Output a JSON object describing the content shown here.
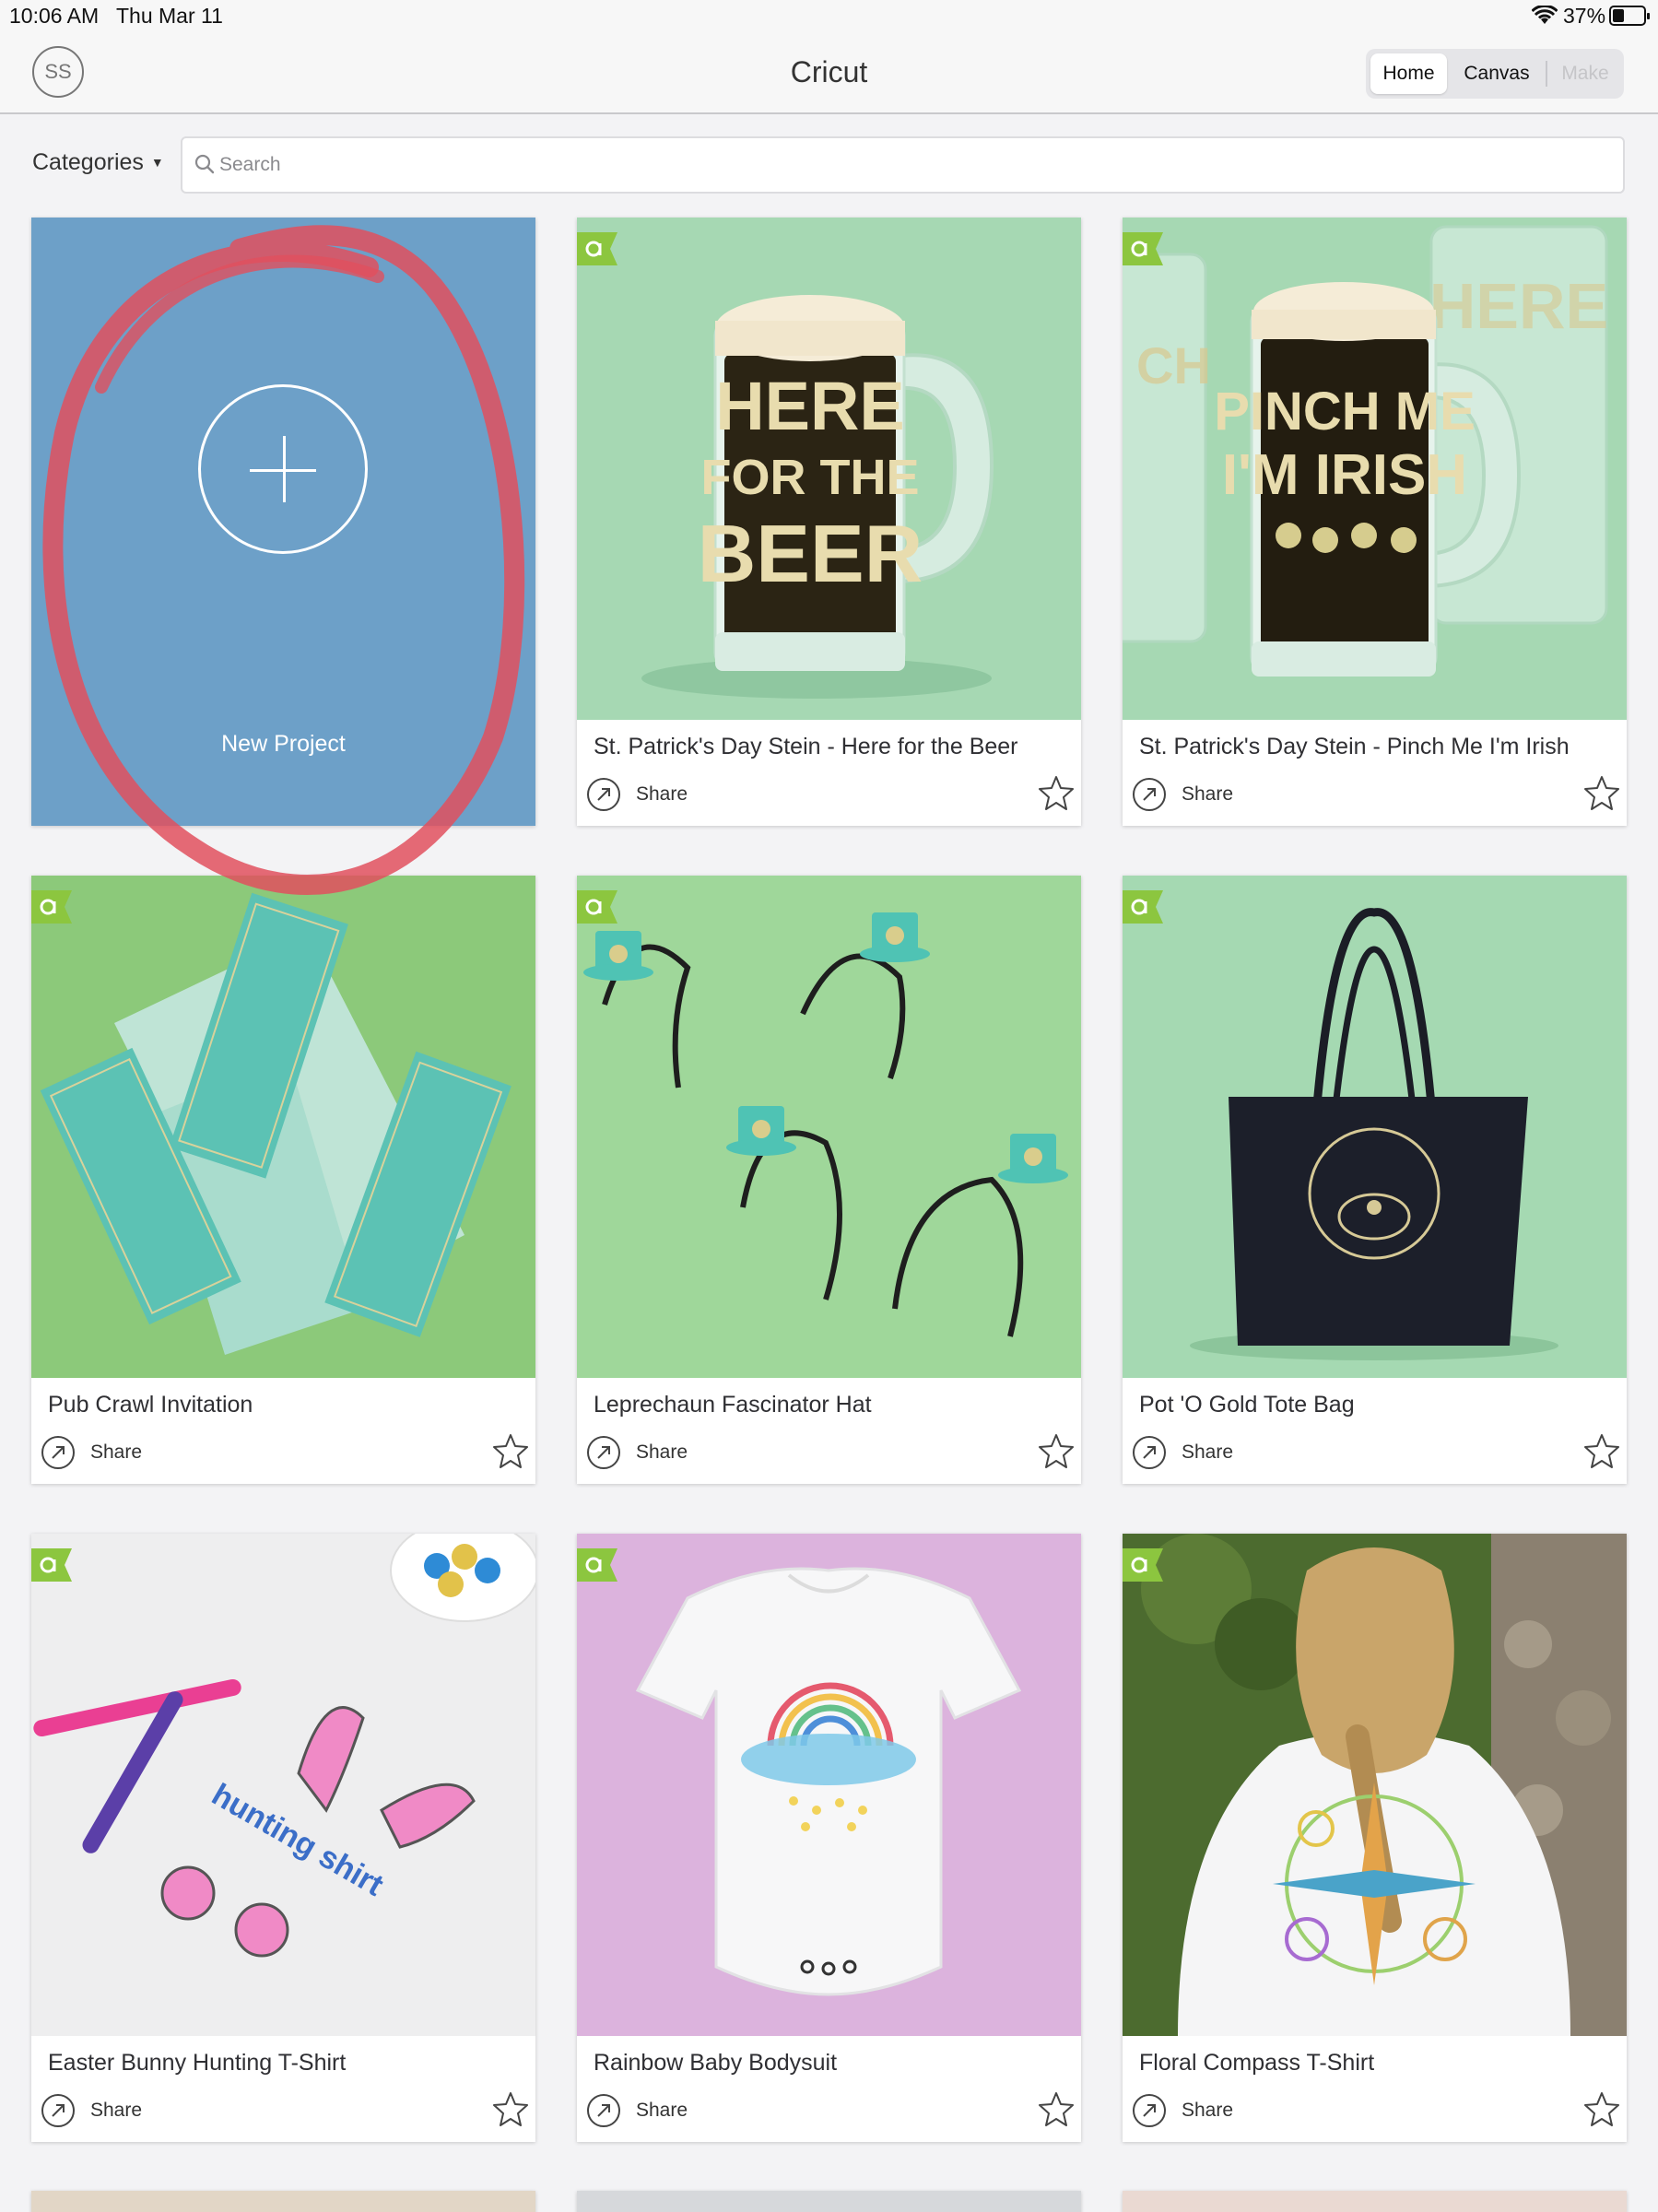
{
  "status_bar": {
    "time": "10:06 AM",
    "date": "Thu Mar 11",
    "battery": "37%"
  },
  "nav": {
    "avatar": "SS",
    "title": "Cricut",
    "tabs": {
      "home": "Home",
      "canvas": "Canvas",
      "make": "Make"
    }
  },
  "filters": {
    "categories": "Categories",
    "search_placeholder": "Search"
  },
  "new_project": {
    "label": "New Project"
  },
  "projects": [
    {
      "title": "St. Patrick's Day Stein - Here for the Beer",
      "share": "Share"
    },
    {
      "title": "St. Patrick's Day Stein - Pinch Me I'm Irish",
      "share": "Share"
    },
    {
      "title": "Pub Crawl Invitation",
      "share": "Share"
    },
    {
      "title": "Leprechaun Fascinator Hat",
      "share": "Share"
    },
    {
      "title": "Pot 'O Gold Tote Bag",
      "share": "Share"
    },
    {
      "title": "Easter Bunny Hunting T-Shirt",
      "share": "Share"
    },
    {
      "title": "Rainbow Baby Bodysuit",
      "share": "Share"
    },
    {
      "title": "Floral Compass T-Shirt",
      "share": "Share"
    }
  ],
  "image_text": {
    "stein1": [
      "HERE",
      "FOR THE",
      "BEER"
    ],
    "stein2": [
      "PINCH ME",
      "I'M IRISH"
    ]
  },
  "colors": {
    "accent_green": "#8cc63f",
    "new_project_bg": "#6da0c8",
    "annotation_red": "#e0505e"
  }
}
